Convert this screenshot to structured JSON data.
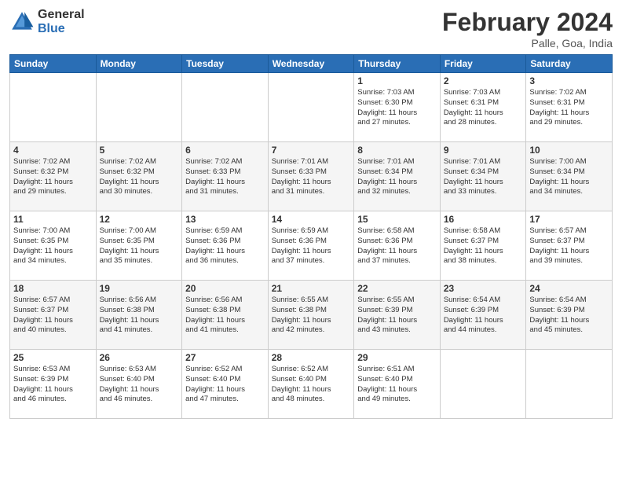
{
  "logo": {
    "general": "General",
    "blue": "Blue"
  },
  "title": "February 2024",
  "location": "Palle, Goa, India",
  "days_of_week": [
    "Sunday",
    "Monday",
    "Tuesday",
    "Wednesday",
    "Thursday",
    "Friday",
    "Saturday"
  ],
  "weeks": [
    [
      {
        "day": "",
        "info": ""
      },
      {
        "day": "",
        "info": ""
      },
      {
        "day": "",
        "info": ""
      },
      {
        "day": "",
        "info": ""
      },
      {
        "day": "1",
        "info": "Sunrise: 7:03 AM\nSunset: 6:30 PM\nDaylight: 11 hours\nand 27 minutes."
      },
      {
        "day": "2",
        "info": "Sunrise: 7:03 AM\nSunset: 6:31 PM\nDaylight: 11 hours\nand 28 minutes."
      },
      {
        "day": "3",
        "info": "Sunrise: 7:02 AM\nSunset: 6:31 PM\nDaylight: 11 hours\nand 29 minutes."
      }
    ],
    [
      {
        "day": "4",
        "info": "Sunrise: 7:02 AM\nSunset: 6:32 PM\nDaylight: 11 hours\nand 29 minutes."
      },
      {
        "day": "5",
        "info": "Sunrise: 7:02 AM\nSunset: 6:32 PM\nDaylight: 11 hours\nand 30 minutes."
      },
      {
        "day": "6",
        "info": "Sunrise: 7:02 AM\nSunset: 6:33 PM\nDaylight: 11 hours\nand 31 minutes."
      },
      {
        "day": "7",
        "info": "Sunrise: 7:01 AM\nSunset: 6:33 PM\nDaylight: 11 hours\nand 31 minutes."
      },
      {
        "day": "8",
        "info": "Sunrise: 7:01 AM\nSunset: 6:34 PM\nDaylight: 11 hours\nand 32 minutes."
      },
      {
        "day": "9",
        "info": "Sunrise: 7:01 AM\nSunset: 6:34 PM\nDaylight: 11 hours\nand 33 minutes."
      },
      {
        "day": "10",
        "info": "Sunrise: 7:00 AM\nSunset: 6:34 PM\nDaylight: 11 hours\nand 34 minutes."
      }
    ],
    [
      {
        "day": "11",
        "info": "Sunrise: 7:00 AM\nSunset: 6:35 PM\nDaylight: 11 hours\nand 34 minutes."
      },
      {
        "day": "12",
        "info": "Sunrise: 7:00 AM\nSunset: 6:35 PM\nDaylight: 11 hours\nand 35 minutes."
      },
      {
        "day": "13",
        "info": "Sunrise: 6:59 AM\nSunset: 6:36 PM\nDaylight: 11 hours\nand 36 minutes."
      },
      {
        "day": "14",
        "info": "Sunrise: 6:59 AM\nSunset: 6:36 PM\nDaylight: 11 hours\nand 37 minutes."
      },
      {
        "day": "15",
        "info": "Sunrise: 6:58 AM\nSunset: 6:36 PM\nDaylight: 11 hours\nand 37 minutes."
      },
      {
        "day": "16",
        "info": "Sunrise: 6:58 AM\nSunset: 6:37 PM\nDaylight: 11 hours\nand 38 minutes."
      },
      {
        "day": "17",
        "info": "Sunrise: 6:57 AM\nSunset: 6:37 PM\nDaylight: 11 hours\nand 39 minutes."
      }
    ],
    [
      {
        "day": "18",
        "info": "Sunrise: 6:57 AM\nSunset: 6:37 PM\nDaylight: 11 hours\nand 40 minutes."
      },
      {
        "day": "19",
        "info": "Sunrise: 6:56 AM\nSunset: 6:38 PM\nDaylight: 11 hours\nand 41 minutes."
      },
      {
        "day": "20",
        "info": "Sunrise: 6:56 AM\nSunset: 6:38 PM\nDaylight: 11 hours\nand 41 minutes."
      },
      {
        "day": "21",
        "info": "Sunrise: 6:55 AM\nSunset: 6:38 PM\nDaylight: 11 hours\nand 42 minutes."
      },
      {
        "day": "22",
        "info": "Sunrise: 6:55 AM\nSunset: 6:39 PM\nDaylight: 11 hours\nand 43 minutes."
      },
      {
        "day": "23",
        "info": "Sunrise: 6:54 AM\nSunset: 6:39 PM\nDaylight: 11 hours\nand 44 minutes."
      },
      {
        "day": "24",
        "info": "Sunrise: 6:54 AM\nSunset: 6:39 PM\nDaylight: 11 hours\nand 45 minutes."
      }
    ],
    [
      {
        "day": "25",
        "info": "Sunrise: 6:53 AM\nSunset: 6:39 PM\nDaylight: 11 hours\nand 46 minutes."
      },
      {
        "day": "26",
        "info": "Sunrise: 6:53 AM\nSunset: 6:40 PM\nDaylight: 11 hours\nand 46 minutes."
      },
      {
        "day": "27",
        "info": "Sunrise: 6:52 AM\nSunset: 6:40 PM\nDaylight: 11 hours\nand 47 minutes."
      },
      {
        "day": "28",
        "info": "Sunrise: 6:52 AM\nSunset: 6:40 PM\nDaylight: 11 hours\nand 48 minutes."
      },
      {
        "day": "29",
        "info": "Sunrise: 6:51 AM\nSunset: 6:40 PM\nDaylight: 11 hours\nand 49 minutes."
      },
      {
        "day": "",
        "info": ""
      },
      {
        "day": "",
        "info": ""
      }
    ]
  ]
}
